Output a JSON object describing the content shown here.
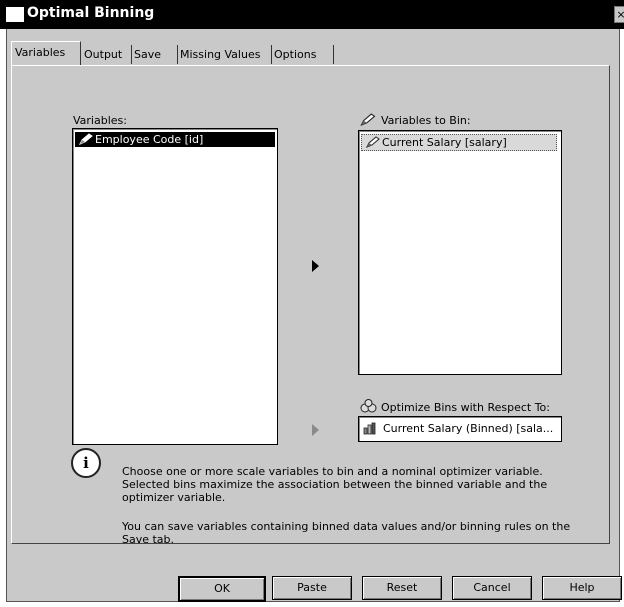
{
  "window": {
    "title": "Optimal Binning",
    "close_label": "×"
  },
  "tabs": [
    {
      "label": "Variables",
      "active": true
    },
    {
      "label": "Output",
      "active": false
    },
    {
      "label": "Save",
      "active": false
    },
    {
      "label": "Missing Values",
      "active": false
    },
    {
      "label": "Options",
      "active": false
    }
  ],
  "source": {
    "label": "Variables:",
    "items": [
      {
        "label": "Employee Code [id]",
        "selected": true
      }
    ]
  },
  "to_bin": {
    "label": "Variables to Bin:",
    "items": [
      {
        "label": "Current Salary [salary]"
      }
    ]
  },
  "optimize": {
    "label": "Optimize Bins with Respect To:",
    "value": "Current Salary (Binned) [sala..."
  },
  "info": {
    "line1": "Choose one or more scale variables to bin and a nominal optimizer variable.",
    "line2": "Selected bins maximize the association between the binned variable and the",
    "line3": "optimizer variable.",
    "line4": "You can save variables containing binned data values and/or binning rules on the",
    "line5": "Save tab."
  },
  "buttons": {
    "ok": "OK",
    "paste": "Paste",
    "reset": "Reset",
    "cancel": "Cancel",
    "help": "Help"
  },
  "icons": {
    "pencil": "pencil-icon",
    "info": "info-icon",
    "optimize": "optimize-icon",
    "nominal": "nominal-variable-icon"
  }
}
